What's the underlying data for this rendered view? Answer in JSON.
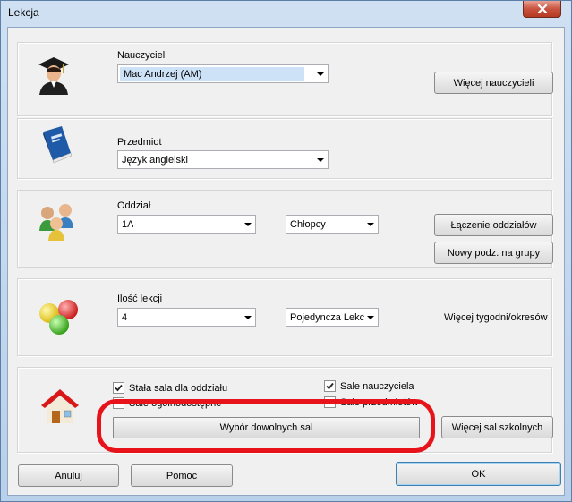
{
  "window": {
    "title": "Lekcja"
  },
  "teacher": {
    "label": "Nauczyciel",
    "value": "Mac Andrzej (AM)",
    "more_button": "Więcej nauczycieli"
  },
  "subject": {
    "label": "Przedmiot",
    "value": "Język angielski"
  },
  "division": {
    "label": "Oddział",
    "value": "1A",
    "group_value": "Chłopcy",
    "join_button": "Łączenie oddziałów",
    "new_split_button": "Nowy podz. na grupy"
  },
  "lessons": {
    "label": "Ilość lekcji",
    "value": "4",
    "type_value": "Pojedyncza Lekc",
    "more_weeks_label": "Więcej tygodni/okresów"
  },
  "rooms": {
    "fixed_room_label": "Stała sala dla oddziału",
    "fixed_room_checked": true,
    "public_rooms_label": "Sale ogólnodostępne",
    "public_rooms_checked": false,
    "teacher_rooms_label": "Sale nauczyciela",
    "teacher_rooms_checked": true,
    "subject_rooms_label": "Sale przedmiotów",
    "subject_rooms_checked": false,
    "choose_rooms_button": "Wybór dowolnych sal",
    "more_rooms_button": "Więcej sal szkolnych"
  },
  "footer": {
    "cancel_button": "Anuluj",
    "help_button": "Pomoc",
    "ok_button": "OK"
  },
  "colors": {
    "highlight": "#e8121a",
    "selection": "#cde1f7"
  }
}
